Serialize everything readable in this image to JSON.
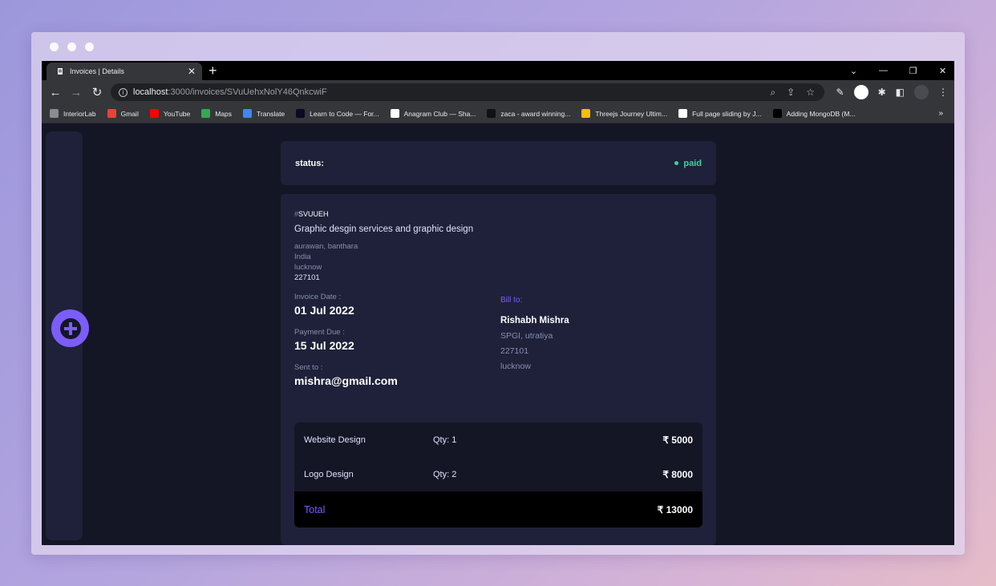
{
  "browser": {
    "tab_title": "Invoices | Details",
    "url_host": "localhost",
    "url_path": ":3000/invoices/SVuUehxNolY46QnkcwiF"
  },
  "bookmarks": [
    {
      "label": "InteriorLab",
      "icon": "globe-icon",
      "color": "#8a8c91"
    },
    {
      "label": "Gmail",
      "icon": "gmail-icon",
      "color": "#ea4335"
    },
    {
      "label": "YouTube",
      "icon": "youtube-icon",
      "color": "#ff0000"
    },
    {
      "label": "Maps",
      "icon": "maps-icon",
      "color": "#34a853"
    },
    {
      "label": "Translate",
      "icon": "translate-icon",
      "color": "#4285f4"
    },
    {
      "label": "Learn to Code — For...",
      "icon": "freecodecamp-icon",
      "color": "#0a0a23"
    },
    {
      "label": "Anagram Club — Sha...",
      "icon": "anagram-icon",
      "color": "#ffffff"
    },
    {
      "label": "zaca - award winning...",
      "icon": "zaca-icon",
      "color": "#111111"
    },
    {
      "label": "Threejs Journey Ultim...",
      "icon": "drive-icon",
      "color": "#fbbc04"
    },
    {
      "label": "Full page sliding by J...",
      "icon": "codepen-icon",
      "color": "#ffffff"
    },
    {
      "label": "Adding MongoDB (M...",
      "icon": "dev-icon",
      "color": "#000000"
    }
  ],
  "bookmarks_more": "»",
  "status": {
    "label": "status:",
    "value": "paid",
    "color": "#33d69f"
  },
  "invoice": {
    "hash": "#",
    "id": "SVUUEH",
    "description": "Graphic desgin services and graphic design",
    "sender": {
      "street": "aurawan, banthara",
      "country": "India",
      "city": "lucknow",
      "zip": "227101"
    },
    "invoice_date_label": "Invoice Date :",
    "invoice_date": "01 Jul 2022",
    "payment_due_label": "Payment Due :",
    "payment_due": "15 Jul 2022",
    "sent_to_label": "Sent to :",
    "sent_to": "mishra@gmail.com",
    "bill_to_label": "Bill to:",
    "client": {
      "name": "Rishabh Mishra",
      "street": "SPGI, utratiya",
      "zip": "227101",
      "city": "lucknow"
    },
    "items": [
      {
        "name": "Website Design",
        "qty": "Qty: 1",
        "price": "₹ 5000"
      },
      {
        "name": "Logo Design",
        "qty": "Qty: 2",
        "price": "₹ 8000"
      }
    ],
    "total_label": "Total",
    "total": "₹ 13000"
  },
  "colors": {
    "accent": "#7c5dfa",
    "card": "#1e2139",
    "background": "#141625"
  }
}
